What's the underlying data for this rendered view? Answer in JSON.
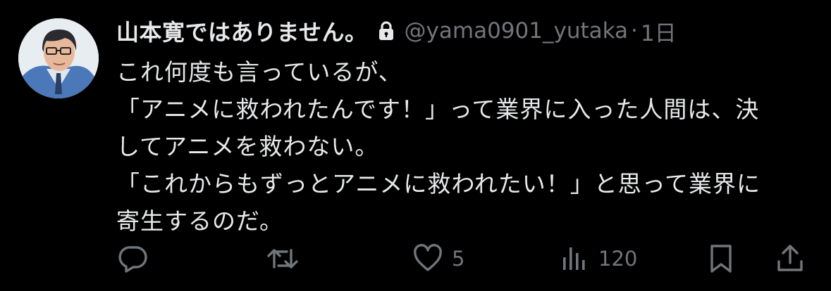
{
  "tweet": {
    "author": {
      "display_name": "山本寛ではありません。",
      "handle": "@yama0901_yutaka",
      "separator": "·",
      "time": "1日",
      "protected_icon": "lock-icon"
    },
    "lines": [
      "これ何度も言っているが、",
      "「アニメに救われたんです！」って業界に入った人間は、決",
      "してアニメを救わない。",
      "「これからもずっとアニメに救われたい！」と思って業界に",
      "寄生するのだ。"
    ],
    "actions": {
      "reply": {
        "icon": "reply-icon",
        "count": ""
      },
      "retweet": {
        "icon": "retweet-icon",
        "count": ""
      },
      "like": {
        "icon": "heart-icon",
        "count": "5"
      },
      "views": {
        "icon": "views-icon",
        "count": "120"
      },
      "bookmark": {
        "icon": "bookmark-icon"
      },
      "share": {
        "icon": "share-icon"
      }
    },
    "colors": {
      "background": "#000000",
      "text": "#e7e9ea",
      "secondary": "#71767b"
    }
  }
}
